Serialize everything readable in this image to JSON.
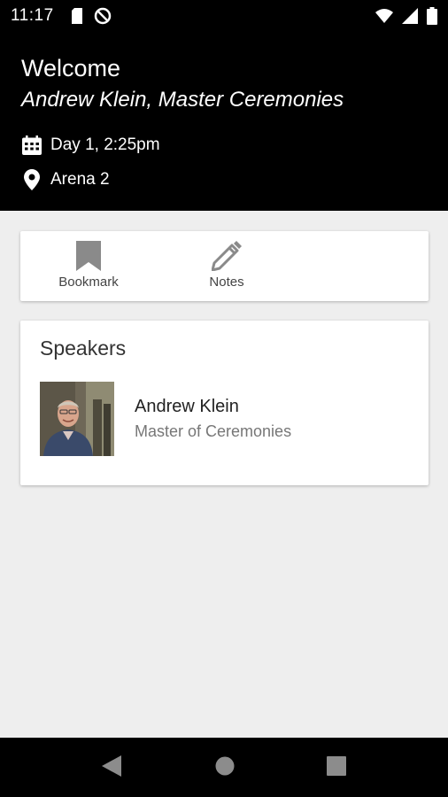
{
  "status_bar": {
    "time": "11:17",
    "icons": [
      "sd-card-icon",
      "do-not-disturb-icon",
      "wifi-icon",
      "signal-icon",
      "battery-icon"
    ]
  },
  "header": {
    "title": "Welcome",
    "subtitle": "Andrew Klein, Master Ceremonies",
    "time_label": "Day 1, 2:25pm",
    "location_label": "Arena 2",
    "background_color": "#000000",
    "text_color": "#ffffff"
  },
  "actions": {
    "bookmark_label": "Bookmark",
    "notes_label": "Notes",
    "icon_color": "#8a8a8a"
  },
  "speakers": {
    "title": "Speakers",
    "items": [
      {
        "name": "Andrew Klein",
        "role": "Master of Ceremonies"
      }
    ]
  },
  "nav_bar": {
    "icons": [
      "back-icon",
      "home-icon",
      "recents-icon"
    ]
  },
  "colors": {
    "page_background": "#eeeeee",
    "card_background": "#ffffff"
  }
}
